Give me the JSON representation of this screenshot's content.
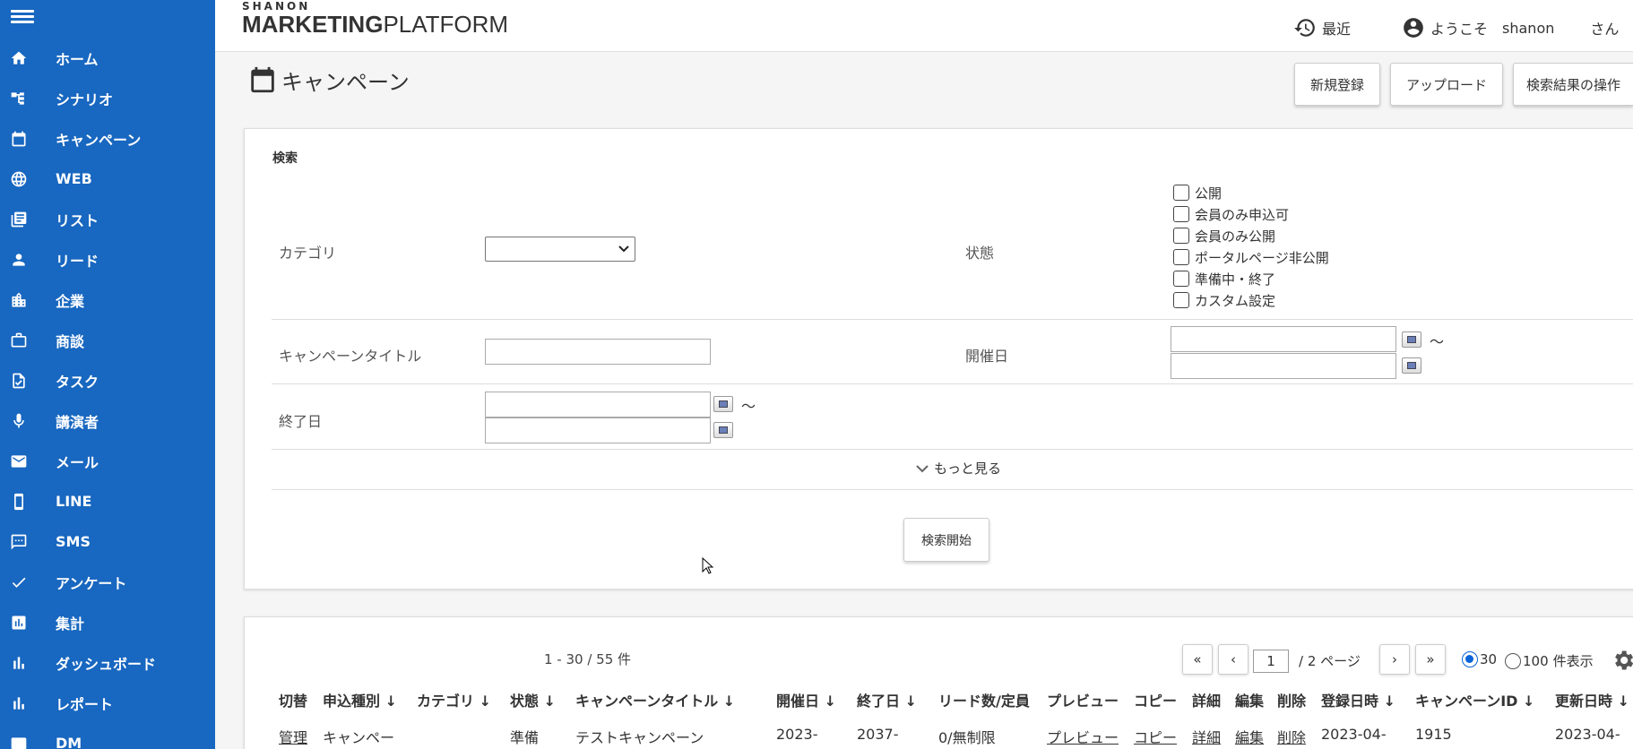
{
  "sidebar": {
    "items": [
      {
        "label": "ホーム",
        "icon": "home-icon"
      },
      {
        "label": "シナリオ",
        "icon": "scenario-icon"
      },
      {
        "label": "キャンペーン",
        "icon": "calendar-icon"
      },
      {
        "label": "WEB",
        "icon": "globe-icon"
      },
      {
        "label": "リスト",
        "icon": "list-icon"
      },
      {
        "label": "リード",
        "icon": "person-icon"
      },
      {
        "label": "企業",
        "icon": "building-icon"
      },
      {
        "label": "商談",
        "icon": "briefcase-icon"
      },
      {
        "label": "タスク",
        "icon": "task-icon"
      },
      {
        "label": "講演者",
        "icon": "microphone-icon"
      },
      {
        "label": "メール",
        "icon": "mail-icon"
      },
      {
        "label": "LINE",
        "icon": "phone-icon"
      },
      {
        "label": "SMS",
        "icon": "sms-icon"
      },
      {
        "label": "アンケート",
        "icon": "check-icon"
      },
      {
        "label": "集計",
        "icon": "tally-icon"
      },
      {
        "label": "ダッシュボード",
        "icon": "dashboard-icon"
      },
      {
        "label": "レポート",
        "icon": "report-icon"
      },
      {
        "label": "DM",
        "icon": "dm-icon"
      }
    ]
  },
  "header": {
    "logo_small": "SHANON",
    "logo_bold": "MARKETING",
    "logo_light": "PLATFORM",
    "recent": "最近",
    "welcome": "ようこそ",
    "username": "shanon",
    "honorific": "さん"
  },
  "page": {
    "title": "キャンペーン",
    "buttons": {
      "new": "新規登録",
      "upload": "アップロード",
      "ops": "検索結果の操作"
    }
  },
  "search": {
    "heading": "検索",
    "category_label": "カテゴリ",
    "category_value": "",
    "status_label": "状態",
    "status_options": [
      "公開",
      "会員のみ申込可",
      "会員のみ公開",
      "ポータルページ非公開",
      "準備中・終了",
      "カスタム設定"
    ],
    "title_label": "キャンペーンタイトル",
    "title_value": "",
    "start_label": "開催日",
    "end_label": "終了日",
    "tilde": "〜",
    "more": "もっと見る",
    "submit": "検索開始"
  },
  "results": {
    "count": "1 - 30 / 55 件",
    "first": "«",
    "prev": "‹",
    "next": "›",
    "last": "»",
    "page": "1",
    "total": "/ 2 ページ",
    "per_30": "30",
    "per_100": "100",
    "per_suffix": "件表示",
    "columns": [
      "切替",
      "申込種別 ↓",
      "カテゴリ ↓",
      "状態 ↓",
      "キャンペーンタイトル ↓",
      "開催日 ↓",
      "終了日 ↓",
      "リード数/定員",
      "プレビュー",
      "コピー",
      "詳細",
      "編集",
      "削除",
      "登録日時 ↓",
      "キャンペーンID ↓",
      "更新日時 ↓"
    ],
    "row": [
      "管理",
      "キャンペー",
      "",
      "準備",
      "テストキャンペーン",
      "2023-",
      "2037-",
      "0/無制限",
      "プレビュー",
      "コピー",
      "詳細",
      "編集",
      "削除",
      "2023-04-",
      "1915",
      "2023-04-"
    ]
  }
}
